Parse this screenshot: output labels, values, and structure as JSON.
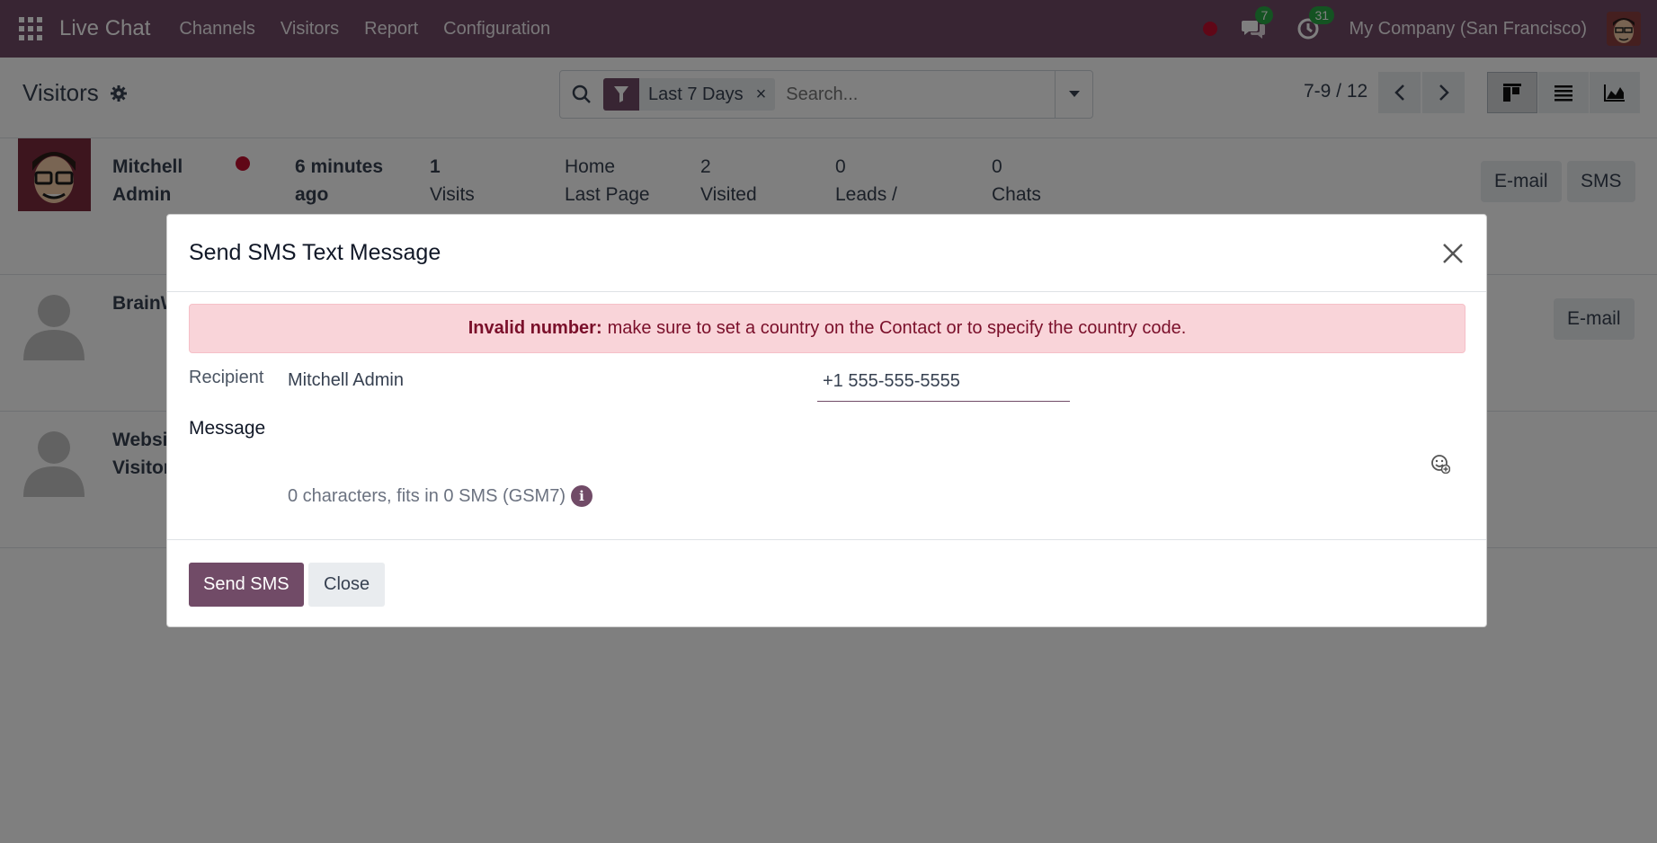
{
  "navbar": {
    "brand": "Live Chat",
    "menu": [
      "Channels",
      "Visitors",
      "Report",
      "Configuration"
    ],
    "messages_badge": "7",
    "activities_badge": "31",
    "company": "My Company (San Francisco)"
  },
  "control_panel": {
    "title": "Visitors",
    "facet": "Last 7 Days",
    "facet_remove": "×",
    "search_placeholder": "Search...",
    "pager": "7-9 / 12"
  },
  "rows": [
    {
      "name": "Mitchell Admin",
      "status_color": "#c10f2f",
      "last_seen": "6 minutes ago",
      "visits_value": "1",
      "visits_label": "Visits",
      "last_page_value": "Home",
      "last_page_label": "Last Page",
      "visited_value": "2",
      "visited_label": "Visited",
      "leads_value": "0",
      "leads_label": "Leads /",
      "chats_value": "0",
      "chats_label": "Chats",
      "email_button": "E-mail",
      "sms_button": "SMS"
    },
    {
      "name": "BrainW",
      "email_button": "E-mail"
    },
    {
      "name": "Websi Visitor"
    }
  ],
  "modal": {
    "title": "Send SMS Text Message",
    "alert_strong": "Invalid number:",
    "alert_text": "make sure to set a country on the Contact or to specify the country code.",
    "recipient_label": "Recipient",
    "recipient_name": "Mitchell Admin",
    "recipient_phone": "+1 555-555-5555",
    "message_label": "Message",
    "char_count": "0 characters, fits in 0 SMS (GSM7)",
    "send_button": "Send SMS",
    "close_button": "Close"
  },
  "colors": {
    "brand": "#714b67",
    "danger_dot": "#c10f2f",
    "badge": "#28a745",
    "alert_bg": "#f9d4d9"
  }
}
